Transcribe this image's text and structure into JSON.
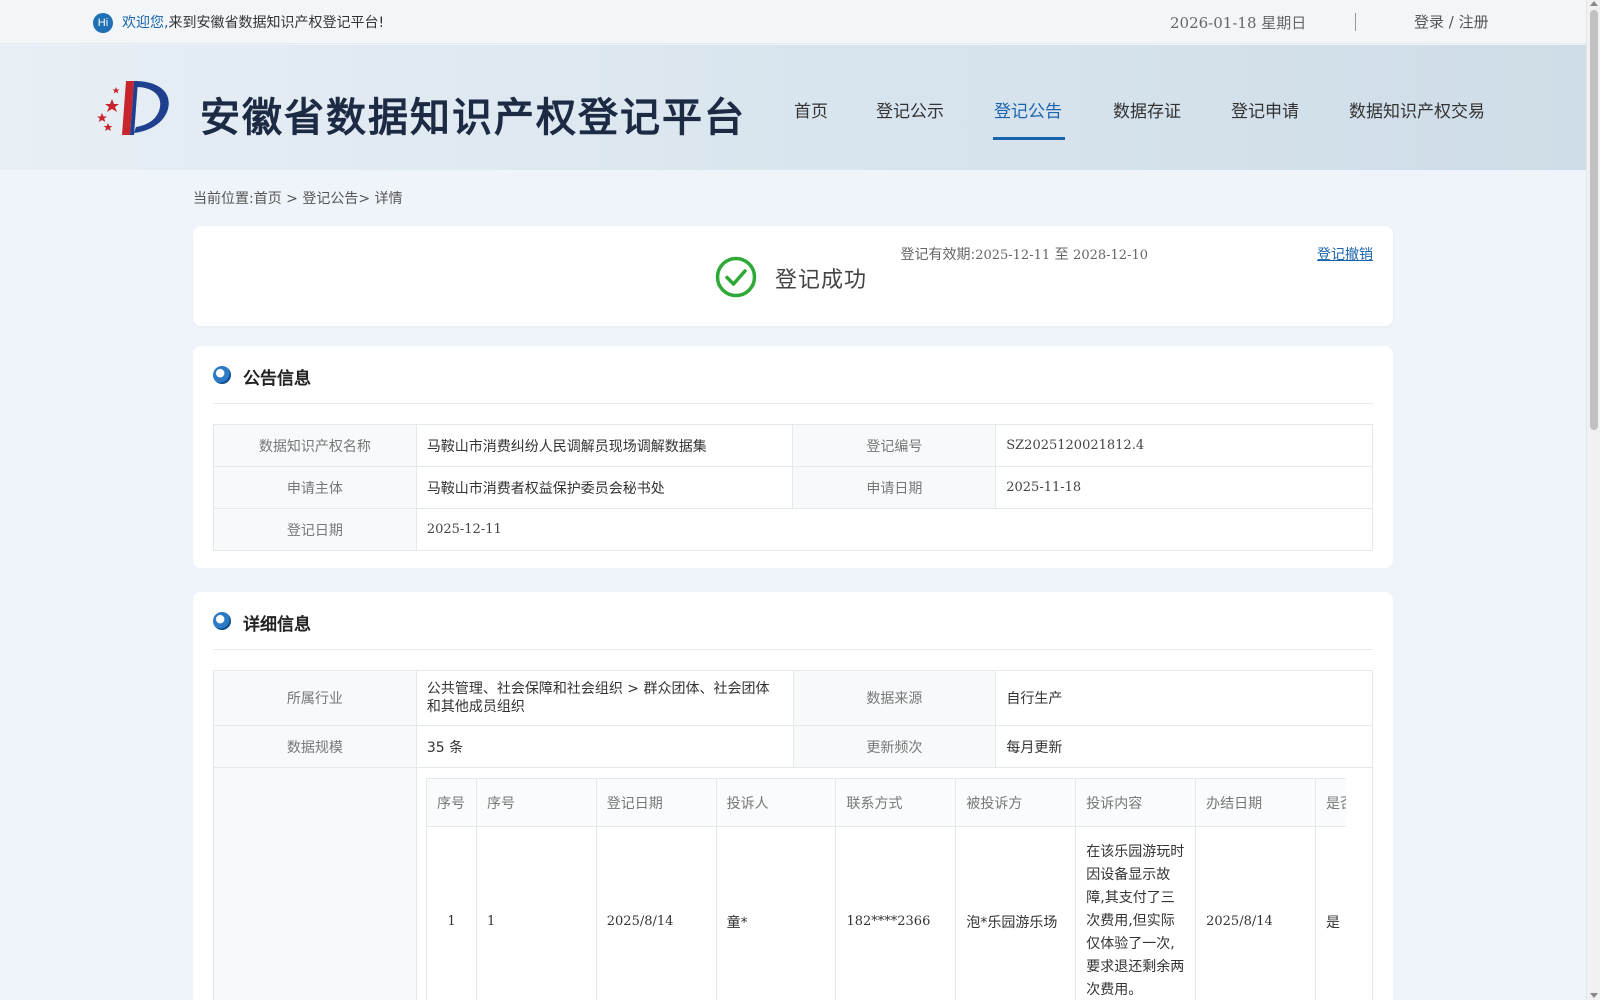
{
  "topbar": {
    "hi_badge": "Hi",
    "welcome_prefix": "欢迎您,",
    "welcome_text": "来到安徽省数据知识产权登记平台!",
    "date": "2026-01-18 星期日",
    "login": "登录",
    "slash": " / ",
    "register": "注册"
  },
  "header": {
    "site_title": "安徽省数据知识产权登记平台",
    "nav": [
      {
        "label": "首页"
      },
      {
        "label": "登记公示"
      },
      {
        "label": "登记公告",
        "active": true
      },
      {
        "label": "数据存证"
      },
      {
        "label": "登记申请"
      },
      {
        "label": "数据知识产权交易"
      }
    ]
  },
  "breadcrumb": {
    "prefix": "当前位置:",
    "home": "首页",
    "sep1": " > ",
    "section": "登记公告",
    "sep2": "> ",
    "current": "详情"
  },
  "status": {
    "validity_label": "登记有效期:",
    "validity_start": "2025-12-11",
    "validity_to": " 至 ",
    "validity_end": "2028-12-10",
    "revoke": "登记撤销",
    "text": "登记成功"
  },
  "announcement": {
    "title": "公告信息",
    "rows": {
      "name_label": "数据知识产权名称",
      "name_value": "马鞍山市消费纠纷人民调解员现场调解数据集",
      "reg_no_label": "登记编号",
      "reg_no_value": "SZ2025120021812.4",
      "applicant_label": "申请主体",
      "applicant_value": "马鞍山市消费者权益保护委员会秘书处",
      "apply_date_label": "申请日期",
      "apply_date_value": "2025-11-18",
      "reg_date_label": "登记日期",
      "reg_date_value": "2025-12-11"
    }
  },
  "detail": {
    "title": "详细信息",
    "industry_label": "所属行业",
    "industry_value": "公共管理、社会保障和社会组织 > 群众团体、社会团体和其他成员组织",
    "source_label": "数据来源",
    "source_value": "自行生产",
    "scale_label": "数据规模",
    "scale_value": "35 条",
    "freq_label": "更新频次",
    "freq_value": "每月更新",
    "sample": {
      "headers": [
        "序号",
        "序号",
        "登记日期",
        "投诉人",
        "联系方式",
        "被投诉方",
        "投诉内容",
        "办结日期",
        "是否"
      ],
      "row": [
        "1",
        "1",
        "2025/8/14",
        "童*",
        "182****2366",
        "泡*乐园游乐场",
        "在该乐园游玩时因设备显示故障,其支付了三次费用,但实际仅体验了一次,要求退还剩余两次费用。",
        "2025/8/14",
        "是"
      ]
    }
  },
  "colors": {
    "accent": "#1a64ad",
    "success": "#2ea836"
  }
}
